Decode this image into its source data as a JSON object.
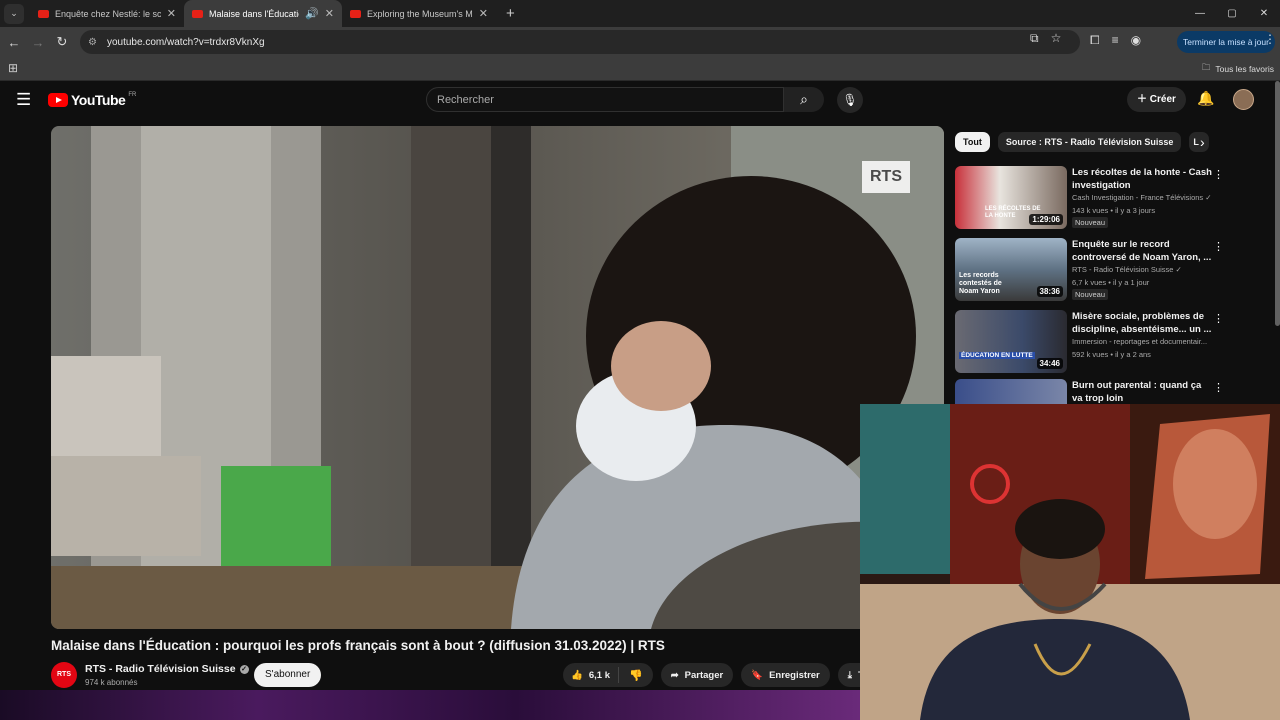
{
  "browser": {
    "tabs": [
      {
        "title": "Enquête chez Nestlé: le scandale"
      },
      {
        "title": "Malaise dans l'Éducation : p"
      },
      {
        "title": "Exploring the Museum's Most"
      }
    ],
    "url": "youtube.com/watch?v=trdxr8VknXg",
    "update_button": "Terminer la mise à jour",
    "bookmarks_label": "Tous les favoris"
  },
  "masthead": {
    "logo_text": "YouTube",
    "logo_country": "FR",
    "search_placeholder": "Rechercher",
    "create_label": "Créer"
  },
  "player": {
    "watermark": "RTS"
  },
  "video": {
    "title": "Malaise dans l'Éducation : pourquoi les profs français sont à bout ? (diffusion 31.03.2022) | RTS",
    "channel_name": "RTS - Radio Télévision Suisse",
    "channel_avatar_text": "RTS",
    "subscribers": "974 k abonnés",
    "subscribe_label": "S'abonner",
    "likes": "6,1 k",
    "share_label": "Partager",
    "save_label": "Enregistrer",
    "download_label": "Té"
  },
  "chips": [
    "Tout",
    "Source : RTS - Radio Télévision Suisse",
    "L"
  ],
  "recommendations": [
    {
      "title": "Les récoltes de la honte - Cash investigation",
      "channel": "Cash Investigation - France Télévisions",
      "views": "143 k vues",
      "age": "il y a 3 jours",
      "badge": "Nouveau",
      "duration": "1:29:06",
      "thumb_text": "LES RÉCOLTES DE LA HONTE",
      "verified": true
    },
    {
      "title": "Enquête sur le record controversé de Noam Yaron, ...",
      "channel": "RTS - Radio Télévision Suisse",
      "views": "6,7 k vues",
      "age": "il y a 1 jour",
      "badge": "Nouveau",
      "duration": "38:36",
      "thumb_text": "Les records contestés de Noam Yaron",
      "verified": true
    },
    {
      "title": "Misère sociale, problèmes de discipline, absentéisme... un ...",
      "channel": "Immersion - reportages et documentair...",
      "views": "592 k vues",
      "age": "il y a 2 ans",
      "badge": "",
      "duration": "34:46",
      "thumb_text": "ÉDUCATION EN LUTTE",
      "verified": false
    },
    {
      "title": "Burn out parental : quand ça va trop loin",
      "channel": "",
      "views": "",
      "age": "",
      "badge": "",
      "duration": "",
      "thumb_text": "",
      "verified": false
    }
  ]
}
